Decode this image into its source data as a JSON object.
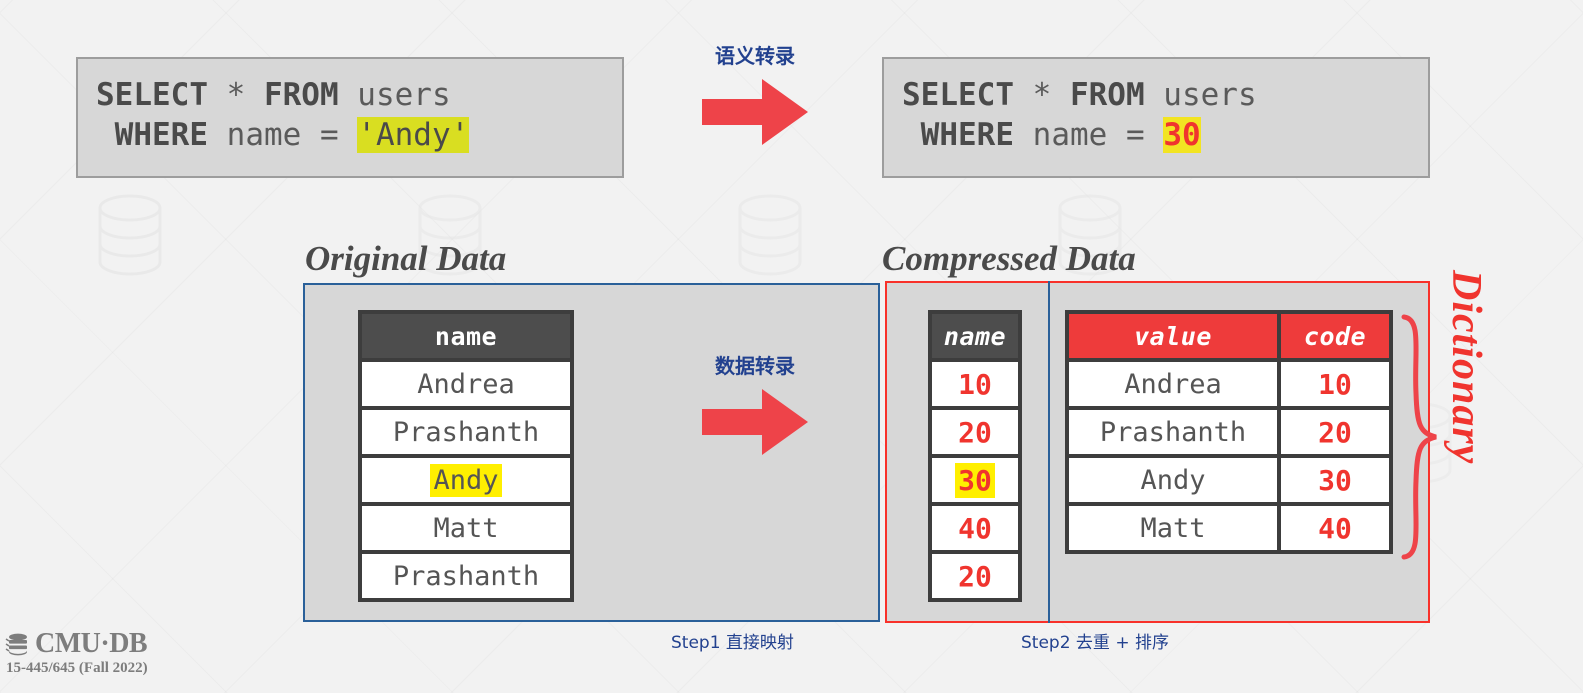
{
  "slide": {
    "background_color": "#f2f2f2",
    "accent_blue": "#2a6099",
    "accent_red": "#f8312a",
    "highlight_yellow": "#ffef00",
    "code_red": "#f0342e"
  },
  "sql_before": {
    "line1_kw1": "SELECT",
    "line1_star": " * ",
    "line1_kw2": "FROM",
    "line1_table": " users",
    "line2_indent": " ",
    "line2_kw": "WHERE",
    "line2_col": " name = ",
    "line2_literal": "'Andy'"
  },
  "sql_after": {
    "line1_kw1": "SELECT",
    "line1_star": " * ",
    "line1_kw2": "FROM",
    "line1_table": " users",
    "line2_indent": " ",
    "line2_kw": "WHERE",
    "line2_col": " name = ",
    "line2_literal": "30"
  },
  "arrows": {
    "top": {
      "label": "语义转录",
      "icon": "right-arrow-icon"
    },
    "middle": {
      "label": "数据转录",
      "icon": "right-arrow-icon"
    }
  },
  "sections": {
    "original_title": "Original Data",
    "compressed_title": "Compressed Data",
    "dictionary_label": "Dictionary"
  },
  "original_table": {
    "header": "name",
    "rows": [
      "Andrea",
      "Prashanth",
      "Andy",
      "Matt",
      "Prashanth"
    ],
    "highlighted_row_index": 2
  },
  "codes_table": {
    "header": "name",
    "rows": [
      "10",
      "20",
      "30",
      "40",
      "20"
    ],
    "highlighted_row_index": 2
  },
  "dictionary_table": {
    "headers": [
      "value",
      "code"
    ],
    "rows": [
      [
        "Andrea",
        "10"
      ],
      [
        "Prashanth",
        "20"
      ],
      [
        "Andy",
        "30"
      ],
      [
        "Matt",
        "40"
      ]
    ]
  },
  "steps": {
    "step1": "Step1 直接映射",
    "step2": "Step2 去重 + 排序"
  },
  "footer": {
    "logo_icon": "database-icon",
    "logo_text": "CMU·DB",
    "course": "15-445/645 (Fall 2022)"
  }
}
